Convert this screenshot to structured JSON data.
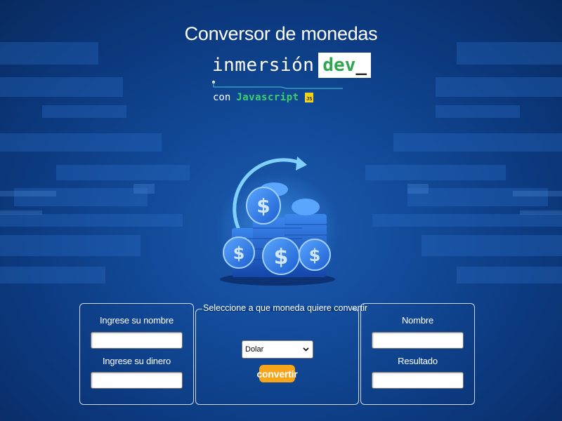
{
  "header": {
    "title": "Conversor de monedas",
    "brand_word": "inmersión",
    "brand_dev": "dev",
    "brand_cursor": "_",
    "con_word": "con",
    "js_word": "Javascript",
    "js_badge": "JS"
  },
  "illustration": {
    "coin_symbol": "$",
    "icon": "coins-stack-with-arrow"
  },
  "left_panel": {
    "name_label": "Ingrese su nombre",
    "name_value": "",
    "money_label": "Ingrese su dinero",
    "money_value": ""
  },
  "middle_panel": {
    "legend": "Seleccione a que moneda quiere convertir",
    "currency_selected": "Dolar",
    "convert_label": "convertir"
  },
  "right_panel": {
    "name_label": "Nombre",
    "name_value": "",
    "result_label": "Resultado",
    "result_value": ""
  },
  "colors": {
    "background": "#124a98",
    "accent_green": "#2ea84f",
    "button_orange": "#f7a51b",
    "js_yellow": "#f2d21b"
  }
}
